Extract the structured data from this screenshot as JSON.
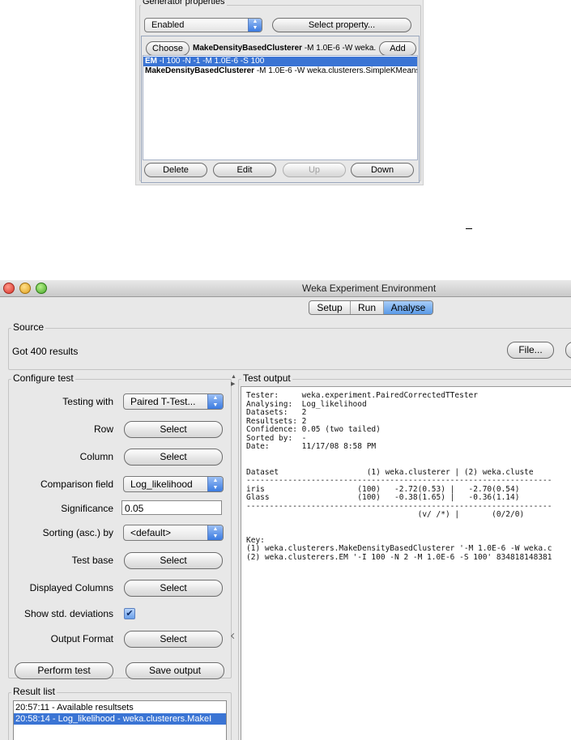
{
  "top_panel": {
    "title": "Generator properties",
    "enabled_combo": "Enabled",
    "select_property_button": "Select property...",
    "choose_button": "Choose",
    "choose_field_bold": "MakeDensityBasedClusterer",
    "choose_field_rest": "-M 1.0E-6 -W weka.c",
    "add_button": "Add",
    "list_items": [
      {
        "bold": "EM",
        "rest": "-I 100 -N -1 -M 1.0E-6 -S 100"
      },
      {
        "bold": "MakeDensityBasedClusterer",
        "rest": "-M 1.0E-6 -W weka.clusterers.SimpleKMeans --"
      }
    ],
    "delete_button": "Delete",
    "edit_button": "Edit",
    "up_button": "Up",
    "down_button": "Down"
  },
  "window": {
    "title": "Weka Experiment Environment",
    "tabs": [
      "Setup",
      "Run",
      "Analyse"
    ],
    "source": {
      "title": "Source",
      "status": "Got 400 results",
      "file_button": "File..."
    },
    "configure": {
      "title": "Configure test",
      "testing_with_label": "Testing with",
      "testing_with_value": "Paired T-Test...",
      "row_label": "Row",
      "column_label": "Column",
      "comparison_label": "Comparison field",
      "comparison_value": "Log_likelihood",
      "significance_label": "Significance",
      "significance_value": "0.05",
      "sorting_label": "Sorting (asc.) by",
      "sorting_value": "<default>",
      "test_base_label": "Test base",
      "displayed_columns_label": "Displayed Columns",
      "show_std_label": "Show std. deviations",
      "output_format_label": "Output Format",
      "select_label": "Select",
      "perform_test_button": "Perform test",
      "save_output_button": "Save output"
    },
    "result_list": {
      "title": "Result list",
      "items": [
        "20:57:11 - Available resultsets",
        "20:58:14 - Log_likelihood - weka.clusterers.MakeI"
      ]
    },
    "test_output": {
      "title": "Test output",
      "lines": [
        "Tester:     weka.experiment.PairedCorrectedTTester",
        "Analysing:  Log_likelihood",
        "Datasets:   2",
        "Resultsets: 2",
        "Confidence: 0.05 (two tailed)",
        "Sorted by:  -",
        "Date:       11/17/08 8:58 PM",
        "",
        "",
        "Dataset                   (1) weka.clusterer | (2) weka.cluste",
        "------------------------------------------------------------------",
        "iris                    (100)   -2.72(0.53) |   -2.70(0.54)",
        "Glass                   (100)   -0.38(1.65) |   -0.36(1.14)",
        "------------------------------------------------------------------",
        "                                     (v/ /*) |       (0/2/0)",
        "",
        "",
        "Key:",
        "(1) weka.clusterers.MakeDensityBasedClusterer '-M 1.0E-6 -W weka.c",
        "(2) weka.clusterers.EM '-I 100 -N 2 -M 1.0E-6 -S 100' 834818148381"
      ]
    }
  }
}
